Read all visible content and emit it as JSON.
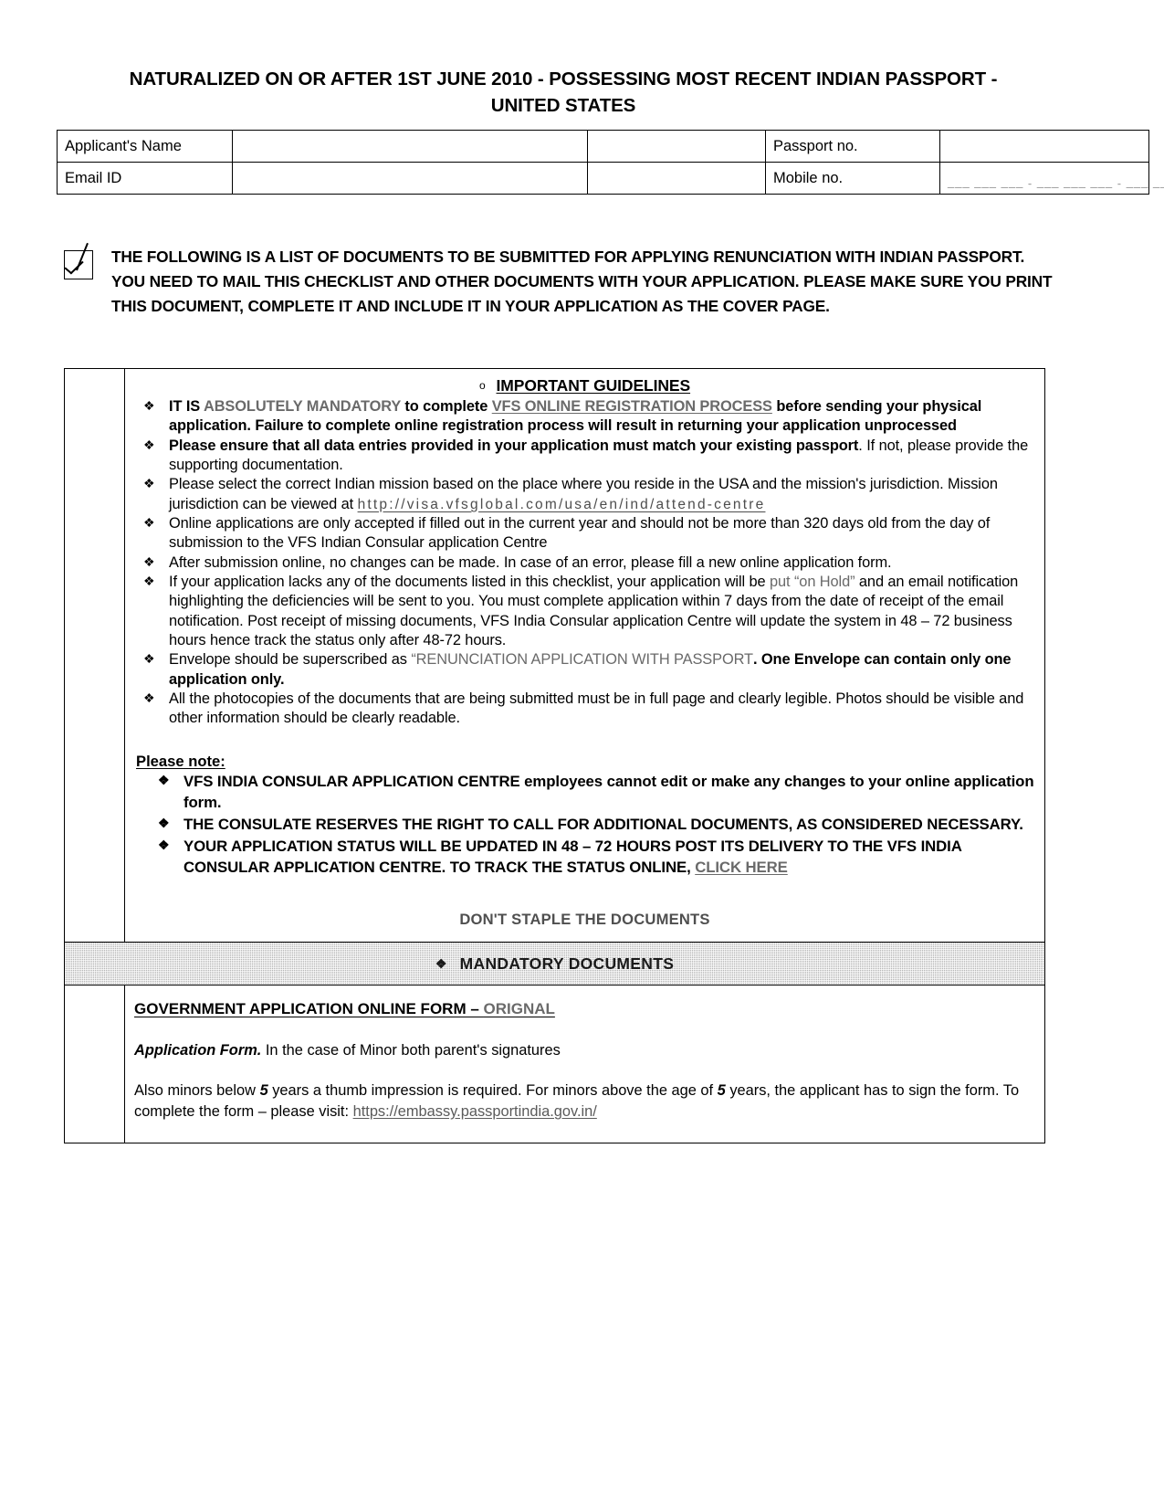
{
  "document": {
    "title_line1": "NATURALIZED ON OR AFTER 1ST JUNE 2010 - POSSESSING MOST RECENT INDIAN PASSPORT -",
    "title_line2": "UNITED STATES"
  },
  "applicant_table": {
    "rows": [
      {
        "label": "Applicant's Name",
        "value": "",
        "blank": "",
        "label2": "Passport no.",
        "value2": ""
      },
      {
        "label": "Email ID",
        "value": "",
        "blank": "",
        "label2": "Mobile no.",
        "value2": "___  ___  ___ - ___  ___  ___ - ___  ___  ___  ___"
      }
    ]
  },
  "notice": {
    "checkbox_icon": "checked-checkbox-icon",
    "text": "THE FOLLOWING IS A LIST OF DOCUMENTS TO BE SUBMITTED FOR APPLYING RENUNCIATION WITH INDIAN PASSPORT. YOU NEED TO MAIL THIS CHECKLIST AND OTHER DOCUMENTS WITH YOUR APPLICATION. PLEASE MAKE SURE YOU PRINT THIS DOCUMENT, COMPLETE IT AND INCLUDE IT IN YOUR APPLICATION AS THE COVER PAGE."
  },
  "guidelines": {
    "circle_marker": "o",
    "heading": "IMPORTANT GUIDELINES",
    "items": [
      {
        "parts": [
          {
            "text": "IT IS ",
            "style": "bold"
          },
          {
            "text": "ABSOLUTELY MANDATORY",
            "style": "bold-gray"
          },
          {
            "text": " to complete ",
            "style": "bold"
          },
          {
            "text": "VFS ONLINE REGISTRATION PROCESS",
            "style": "bold-gray-underline"
          },
          {
            "text": " before sending your physical application. Failure to complete online registration process will result in returning your application unprocessed",
            "style": "bold"
          }
        ]
      },
      {
        "parts": [
          {
            "text": "Please ensure that all data entries provided in your application must match your existing passport",
            "style": "bold"
          },
          {
            "text": ". If not, please provide the supporting documentation.",
            "style": "normal"
          }
        ]
      },
      {
        "parts": [
          {
            "text": "Please select the correct Indian mission based on the place where you reside in the USA and the mission's jurisdiction. Mission jurisdiction can be viewed at ",
            "style": "normal"
          },
          {
            "text": "http://visa.vfsglobal.com/usa/en/ind/attend-centre",
            "style": "url"
          }
        ]
      },
      {
        "parts": [
          {
            "text": "Online applications are only accepted if filled out in the current year and should not be more than 320 days old from the day of submission to the VFS Indian Consular application Centre",
            "style": "normal"
          }
        ]
      },
      {
        "parts": [
          {
            "text": "After submission online, no changes can be made. In case of an error, please fill a new online application form.",
            "style": "normal"
          }
        ]
      },
      {
        "parts": [
          {
            "text": "If your application lacks any of the documents listed in this checklist, your application will be ",
            "style": "normal"
          },
          {
            "text": "put “on Hold”",
            "style": "gray"
          },
          {
            "text": " and an email notification highlighting the deficiencies will be sent to you. You must complete application within 7 days from the date of receipt of the email notification. Post receipt of missing documents, VFS India Consular application Centre will update the system in 48 – 72 business hours hence track the status only after 48-72 hours.",
            "style": "normal"
          }
        ]
      },
      {
        "parts": [
          {
            "text": "Envelope should be superscribed as ",
            "style": "normal"
          },
          {
            "text": "“RENUNCIATION APPLICATION WITH PASSPORT",
            "style": "gray"
          },
          {
            "text": ". One Envelope can contain only one application only.",
            "style": "bold"
          }
        ]
      },
      {
        "parts": [
          {
            "text": "All the photocopies of the documents that are being submitted must be in full page and clearly legible. Photos should be visible and other information should be clearly readable.",
            "style": "normal"
          }
        ]
      }
    ]
  },
  "please_note": {
    "heading": "Please note:",
    "items": [
      {
        "parts": [
          {
            "text": "VFS INDIA CONSULAR APPLICATION CENTRE",
            "style": "bold"
          },
          {
            "text": " employees cannot edit or make any changes to your online application form.",
            "style": "bold"
          }
        ]
      },
      {
        "parts": [
          {
            "text": "THE CONSULATE RESERVES THE RIGHT TO CALL FOR ADDITIONAL DOCUMENTS, AS CONSIDERED NECESSARY.",
            "style": "bold"
          }
        ]
      },
      {
        "parts": [
          {
            "text": "YOUR APPLICATION STATUS WILL BE UPDATED IN 48 – 72 HOURS POST ITS DELIVERY TO THE VFS INDIA CONSULAR APPLICATION CENTRE. TO TRACK THE STATUS ONLINE, ",
            "style": "bold"
          },
          {
            "text": "CLICK HERE",
            "style": "bold-gray-underline"
          }
        ]
      }
    ]
  },
  "dont_staple": "DON'T STAPLE THE DOCUMENTS",
  "mandatory_bar": {
    "diamond": "❖",
    "label": "MANDATORY DOCUMENTS"
  },
  "bottom_section": {
    "form_title_main": "GOVERNMENT APPLICATION ONLINE FORM – ",
    "form_title_gray": "ORIGNAL",
    "paragraph1_bold_italic": "Application Form.",
    "paragraph1_rest": " In the case of Minor both parent's signatures",
    "paragraph2_pre": "Also minors below ",
    "paragraph2_num1": "5",
    "paragraph2_mid": " years a thumb impression is required. For minors above the age of ",
    "paragraph2_num2": "5",
    "paragraph2_mid2": " years, the applicant has to sign the form. To complete the form – please visit: ",
    "paragraph2_link": "https://embassy.passportindia.gov.in/"
  },
  "colors": {
    "ink": "#000000",
    "faded_ink": "#6a6a6a",
    "bar_gray": "#b5b5b5"
  }
}
